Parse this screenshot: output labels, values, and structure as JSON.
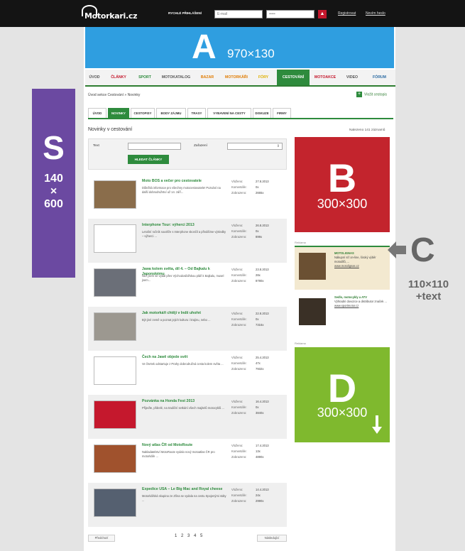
{
  "topbar": {
    "logo": "Motorkari.cz",
    "login_label": "RYCHLÉ PŘIHLÁŠENÍ",
    "email_placeholder": "E-mail",
    "password_value": "•••••",
    "register": "Registrovat",
    "forgot": "Nevím heslo"
  },
  "bannerA": {
    "letter": "A",
    "size": "970×130"
  },
  "mainnav": [
    {
      "label": "ÚVOD",
      "color": "#555555"
    },
    {
      "label": "ČLÁNKY",
      "color": "#c5182d"
    },
    {
      "label": "SPORT",
      "color": "#2e8b3d"
    },
    {
      "label": "MOTOKATALOG",
      "color": "#555555"
    },
    {
      "label": "BAZAR",
      "color": "#e07b00"
    },
    {
      "label": "MOTORKÁŘI",
      "color": "#e07b00"
    },
    {
      "label": "FÓRY",
      "color": "#e0b000"
    },
    {
      "label": "CESTOVÁNÍ",
      "color": "#ffffff"
    },
    {
      "label": "MOTOAKCE",
      "color": "#c5182d"
    },
    {
      "label": "VIDEO",
      "color": "#555555"
    },
    {
      "label": "FÓRUM",
      "color": "#2e6da4"
    }
  ],
  "breadcrumb": "Úvod sekce Cestování  »  Novinky",
  "add_button": "Vložit cestopis",
  "subtabs": [
    "ÚVOD",
    "NOVINKY",
    "CESTOPISY",
    "BODY ZÁJMU",
    "TRASY",
    "VYBAVENÍ NA CESTY",
    "DISKUZE",
    "FIRMY"
  ],
  "section_title": "Novinky v cestování",
  "count": "Nalezeno 141 záznamů",
  "filter": {
    "text_label": "Text",
    "category_label": "Zařazení",
    "button": "HLEDAT ČLÁNKY"
  },
  "meta_labels": {
    "published": "Vloženo:",
    "comments": "Komentáře:",
    "views": "Zobrazeno:"
  },
  "articles": [
    {
      "title": "Moto BOS a večer pro cestovatele",
      "excerpt": "Důležitá informace pro všechny motocestovatele! Pozvání na další dobrodružství už 14. září...",
      "date": "27.8.2013",
      "comments": "0x",
      "views": "2665x",
      "thumb_color": "#8a6d4b"
    },
    {
      "title": "Interphone Tour: výherci 2013",
      "excerpt": "Letošní ročník soutěže s Interphone skončil a přinášíme výsledky – výherci ...",
      "date": "26.8.2013",
      "comments": "0x",
      "views": "899x",
      "thumb_color": "#ffffff"
    },
    {
      "title": "Jawa kolem světa, díl 4. – Od Bajkalu k Japonskému",
      "excerpt": "Než jsem se vydal přes Východosibiřskou pláň k Bajkalu, musel jsem...",
      "date": "23.8.2013",
      "comments": "28x",
      "views": "8780x",
      "thumb_color": "#6b6f78"
    },
    {
      "title": "Jak motorkáři chtějí v Indii uhořet",
      "excerpt": "Být jiné země a poznat jejich kulturu i krajinu, nebo ...",
      "date": "22.8.2013",
      "comments": "0x",
      "views": "7316x",
      "thumb_color": "#9c9890"
    },
    {
      "title": "Čech na Jawě objede svět",
      "excerpt": "Ve čtvrtek odstartuje z Prahy dobrodružná cesta kolem světa ...",
      "date": "25.4.2013",
      "comments": "47x",
      "views": "7932x",
      "thumb_color": "#ffffff"
    },
    {
      "title": "Pozvánka na Honda Fest 2013",
      "excerpt": "Přijeďte, přátelé, na tradiční setkání všech majitelů motocyklů ...",
      "date": "16.4.2013",
      "comments": "0x",
      "views": "3840x",
      "thumb_color": "#c5182d"
    },
    {
      "title": "Nový atlas ČR od MotoRoute",
      "excerpt": "Nakladatelství MotoRoute vydalo nový motoatlas ČR pro motorkáře ...",
      "date": "17.4.2013",
      "comments": "13x",
      "views": "4890x",
      "thumb_color": "#a0522d"
    },
    {
      "title": "Expedice USA – Le Big Mac and Royal cheese",
      "excerpt": "Motorkářská skupina ze Zlína se vydala na cestu Spojenými státy ...",
      "date": "14.4.2013",
      "comments": "24x",
      "views": "2990x",
      "thumb_color": "#556070"
    }
  ],
  "pager": {
    "prev": "Předchozí",
    "pages": "1 2 3 4 5",
    "next": "Následující"
  },
  "adB": {
    "letter": "B",
    "size": "300×300"
  },
  "adC": {
    "reklama": "Reklama",
    "items": [
      {
        "head": "MOTOLIGNAS",
        "text": "Nákupní síť on-line, široký výběr motodílů, ...",
        "link": "www.motolignas.cz",
        "color": "#6b5033"
      },
      {
        "head": "Sedlo, motocykly a ATV",
        "text": "Výhradní dovozce a distributor značek ...",
        "link": "www.sportmotor.cz",
        "color": "#3a3026"
      }
    ]
  },
  "adD": {
    "reklama": "Reklama",
    "letter": "D",
    "size": "300×300"
  },
  "sky": {
    "letter": "S",
    "line1": "140",
    "line2": "×",
    "line3": "600"
  },
  "adC_label": {
    "letter": "C",
    "line1": "110×110",
    "line2": "+text"
  }
}
